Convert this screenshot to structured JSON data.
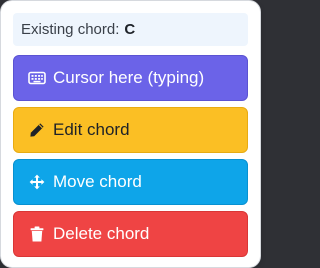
{
  "existing": {
    "label": "Existing chord:",
    "value": "C"
  },
  "buttons": {
    "cursor": {
      "label": "Cursor here (typing)",
      "icon": "keyboard-icon",
      "color": "#6b63e8"
    },
    "edit": {
      "label": "Edit chord",
      "icon": "pencil-icon",
      "color": "#fbbf24"
    },
    "move": {
      "label": "Move chord",
      "icon": "move-arrows-icon",
      "color": "#0ea5e9"
    },
    "delete": {
      "label": "Delete chord",
      "icon": "trash-icon",
      "color": "#ef4444"
    }
  }
}
